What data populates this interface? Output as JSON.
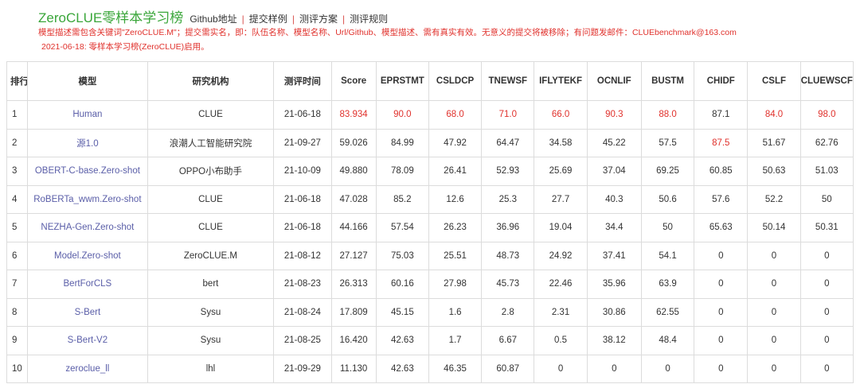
{
  "header": {
    "title": "ZeroCLUE零样本学习榜",
    "nav": [
      "Github地址",
      "提交样例",
      "测评方案",
      "测评规则"
    ],
    "sep": "|",
    "notice1": "模型描述需包含关键词\"ZeroCLUE.M\"；提交需实名，即：队伍名称、模型名称、Url/Github、模型描述、需有真实有效。无意义的提交将被移除；有问题发邮件：CLUEbenchmark@163.com",
    "notice2": "2021-06-18: 零样本学习榜(ZeroCLUE)启用。"
  },
  "table": {
    "columns": [
      "排行",
      "模型",
      "研究机构",
      "测评时间",
      "Score",
      "EPRSTMT",
      "CSLDCP",
      "TNEWSF",
      "IFLYTEKF",
      "OCNLIF",
      "BUSTM",
      "CHIDF",
      "CSLF",
      "CLUEWSCF"
    ],
    "rows": [
      {
        "cells": [
          "1",
          "Human",
          "CLUE",
          "21-06-18",
          "83.934",
          "90.0",
          "68.0",
          "71.0",
          "66.0",
          "90.3",
          "88.0",
          "87.1",
          "84.0",
          "98.0"
        ],
        "red": [
          4,
          5,
          6,
          7,
          8,
          9,
          10,
          12,
          13
        ]
      },
      {
        "cells": [
          "2",
          "源1.0",
          "浪潮人工智能研究院",
          "21-09-27",
          "59.026",
          "84.99",
          "47.92",
          "64.47",
          "34.58",
          "45.22",
          "57.5",
          "87.5",
          "51.67",
          "62.76"
        ],
        "red": [
          11
        ]
      },
      {
        "cells": [
          "3",
          "OBERT-C-base.Zero-shot",
          "OPPO小布助手",
          "21-10-09",
          "49.880",
          "78.09",
          "26.41",
          "52.93",
          "25.69",
          "37.04",
          "69.25",
          "60.85",
          "50.63",
          "51.03"
        ],
        "red": []
      },
      {
        "cells": [
          "4",
          "RoBERTa_wwm.Zero-shot",
          "CLUE",
          "21-06-18",
          "47.028",
          "85.2",
          "12.6",
          "25.3",
          "27.7",
          "40.3",
          "50.6",
          "57.6",
          "52.2",
          "50"
        ],
        "red": []
      },
      {
        "cells": [
          "5",
          "NEZHA-Gen.Zero-shot",
          "CLUE",
          "21-06-18",
          "44.166",
          "57.54",
          "26.23",
          "36.96",
          "19.04",
          "34.4",
          "50",
          "65.63",
          "50.14",
          "50.31"
        ],
        "red": []
      },
      {
        "cells": [
          "6",
          "Model.Zero-shot",
          "ZeroCLUE.M",
          "21-08-12",
          "27.127",
          "75.03",
          "25.51",
          "48.73",
          "24.92",
          "37.41",
          "54.1",
          "0",
          "0",
          "0"
        ],
        "red": []
      },
      {
        "cells": [
          "7",
          "BertForCLS",
          "bert",
          "21-08-23",
          "26.313",
          "60.16",
          "27.98",
          "45.73",
          "22.46",
          "35.96",
          "63.9",
          "0",
          "0",
          "0"
        ],
        "red": []
      },
      {
        "cells": [
          "8",
          "S-Bert",
          "Sysu",
          "21-08-24",
          "17.809",
          "45.15",
          "1.6",
          "2.8",
          "2.31",
          "30.86",
          "62.55",
          "0",
          "0",
          "0"
        ],
        "red": []
      },
      {
        "cells": [
          "9",
          "S-Bert-V2",
          "Sysu",
          "21-08-25",
          "16.420",
          "42.63",
          "1.7",
          "6.67",
          "0.5",
          "38.12",
          "48.4",
          "0",
          "0",
          "0"
        ],
        "red": []
      },
      {
        "cells": [
          "10",
          "zeroclue_ll",
          "lhl",
          "21-09-29",
          "11.130",
          "42.63",
          "46.35",
          "60.87",
          "0",
          "0",
          "0",
          "0",
          "0",
          "0"
        ],
        "red": []
      }
    ]
  }
}
